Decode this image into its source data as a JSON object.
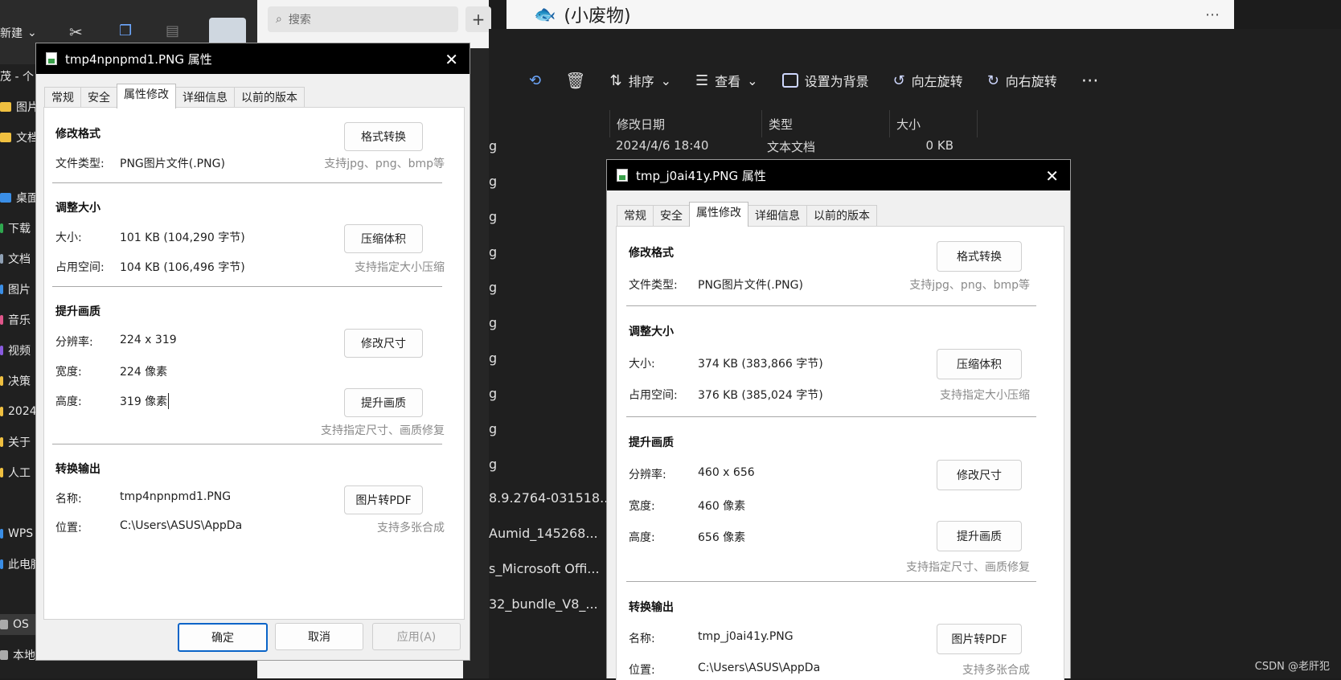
{
  "explorer_left": {
    "new_label": "新建",
    "sidebar": [
      "茂 - 个",
      "图片",
      "文档",
      "桌面",
      "下载",
      "文档",
      "图片",
      "音乐",
      "视频",
      "决策",
      "2024",
      "关于",
      "人工",
      "WPS",
      "此电脑",
      "OS",
      "本地"
    ]
  },
  "search": {
    "placeholder": "搜索"
  },
  "app_title": "(小废物)",
  "toolbar": {
    "sort": "排序",
    "view": "查看",
    "set_background": "设置为背景",
    "rotate_left": "向左旋转",
    "rotate_right": "向右旋转"
  },
  "file_list": {
    "headers": [
      "修改日期",
      "类型",
      "大小"
    ],
    "first_row": {
      "date": "2024/4/6 18:40",
      "type": "文本文档",
      "size": "0 KB"
    },
    "fragments": [
      "g",
      "g",
      "g",
      "g",
      "g",
      "g",
      "g",
      "g",
      "g",
      "g",
      "8.9.2764-031518...",
      "Aumid_145268...",
      "s_Microsoft Offi...",
      "32_bundle_V8_..."
    ]
  },
  "dialog1": {
    "title": "tmp4npnpmd1.PNG 属性",
    "tabs": [
      "常规",
      "安全",
      "属性修改",
      "详细信息",
      "以前的版本"
    ],
    "active_tab": "属性修改",
    "format": {
      "title": "修改格式",
      "type_label": "文件类型:",
      "type_value": "PNG图片文件(.PNG)",
      "button": "格式转换",
      "hint": "支持jpg、png、bmp等"
    },
    "size": {
      "title": "调整大小",
      "size_label": "大小:",
      "size_value": "101 KB (104,290 字节)",
      "disk_label": "占用空间:",
      "disk_value": "104 KB (106,496 字节)",
      "button": "压缩体积",
      "hint": "支持指定大小压缩"
    },
    "quality": {
      "title": "提升画质",
      "res_label": "分辨率:",
      "res_value": "224 x 319",
      "width_label": "宽度:",
      "width_value": "224 像素",
      "height_label": "高度:",
      "height_value": "319 像素",
      "resize_button": "修改尺寸",
      "enhance_button": "提升画质",
      "hint": "支持指定尺寸、画质修复"
    },
    "output": {
      "title": "转换输出",
      "name_label": "名称:",
      "name_value": "tmp4npnpmd1.PNG",
      "loc_label": "位置:",
      "loc_value": "C:\\Users\\ASUS\\AppDa",
      "button": "图片转PDF",
      "hint": "支持多张合成"
    },
    "footer": {
      "ok": "确定",
      "cancel": "取消",
      "apply": "应用(A)"
    }
  },
  "dialog2": {
    "title": "tmp_j0ai41y.PNG 属性",
    "tabs": [
      "常规",
      "安全",
      "属性修改",
      "详细信息",
      "以前的版本"
    ],
    "active_tab": "属性修改",
    "format": {
      "title": "修改格式",
      "type_label": "文件类型:",
      "type_value": "PNG图片文件(.PNG)",
      "button": "格式转换",
      "hint": "支持jpg、png、bmp等"
    },
    "size": {
      "title": "调整大小",
      "size_label": "大小:",
      "size_value": "374 KB (383,866 字节)",
      "disk_label": "占用空间:",
      "disk_value": "376 KB (385,024 字节)",
      "button": "压缩体积",
      "hint": "支持指定大小压缩"
    },
    "quality": {
      "title": "提升画质",
      "res_label": "分辨率:",
      "res_value": "460 x 656",
      "width_label": "宽度:",
      "width_value": "460 像素",
      "height_label": "高度:",
      "height_value": "656 像素",
      "resize_button": "修改尺寸",
      "enhance_button": "提升画质",
      "hint": "支持指定尺寸、画质修复"
    },
    "output": {
      "title": "转换输出",
      "name_label": "名称:",
      "name_value": "tmp_j0ai41y.PNG",
      "loc_label": "位置:",
      "loc_value": "C:\\Users\\ASUS\\AppDa",
      "button": "图片转PDF",
      "hint": "支持多张合成"
    }
  },
  "watermark": "CSDN @老肝犯",
  "colors": {
    "accent": "#0a64c8",
    "dialog_title_bg": "#000000",
    "explorer_bg": "#1f1f1f"
  }
}
